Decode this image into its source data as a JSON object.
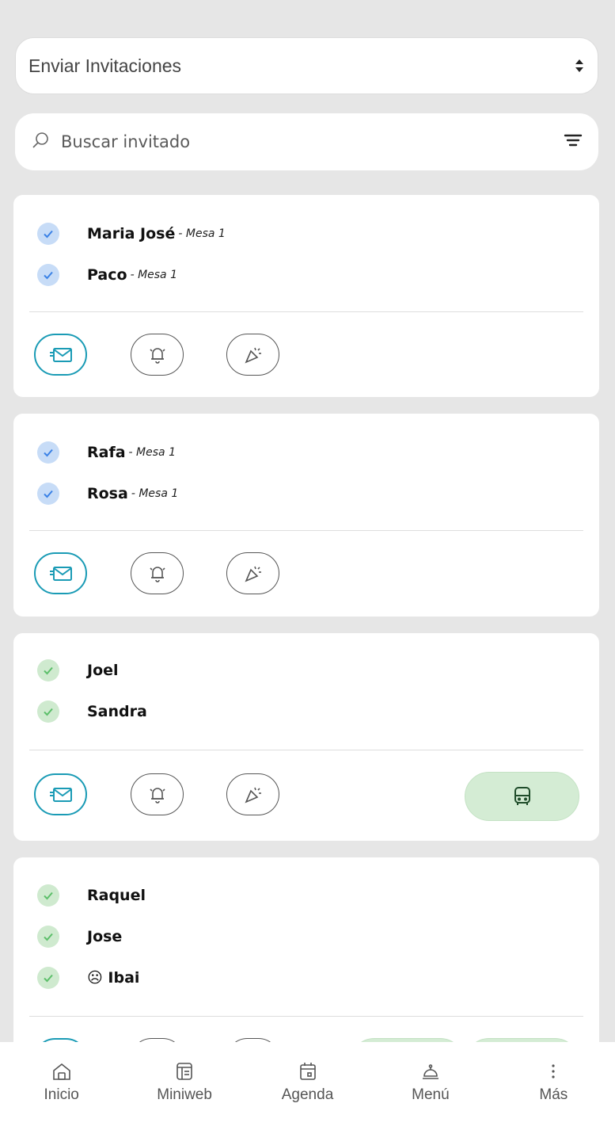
{
  "header": {
    "select_value": "Enviar Invitaciones",
    "search_placeholder": "Buscar invitado"
  },
  "groups": [
    {
      "guests": [
        {
          "name": "Maria José",
          "mesa": "- Mesa 1",
          "status": "blue"
        },
        {
          "name": "Paco",
          "mesa": "- Mesa 1",
          "status": "blue"
        }
      ],
      "actions": [
        "mail-icon",
        "bell-icon",
        "party-icon"
      ]
    },
    {
      "guests": [
        {
          "name": "Rafa",
          "mesa": "- Mesa 1",
          "status": "blue"
        },
        {
          "name": "Rosa",
          "mesa": "- Mesa 1",
          "status": "blue"
        }
      ],
      "actions": [
        "mail-icon",
        "bell-icon",
        "party-icon"
      ]
    },
    {
      "guests": [
        {
          "name": "Joel",
          "mesa": "",
          "status": "green"
        },
        {
          "name": "Sandra",
          "mesa": "",
          "status": "green"
        }
      ],
      "actions": [
        "mail-icon",
        "bell-icon",
        "party-icon",
        "bus-icon"
      ]
    },
    {
      "guests": [
        {
          "name": "Raquel",
          "mesa": "",
          "status": "green"
        },
        {
          "name": "Jose",
          "mesa": "",
          "status": "green"
        },
        {
          "name": "☹ Ibai",
          "mesa": "",
          "status": "green"
        }
      ],
      "actions": [
        "mail-icon",
        "bell-icon",
        "party-icon",
        "bus-icon",
        "bus-icon"
      ]
    }
  ],
  "nav": {
    "items": [
      {
        "label": "Inicio",
        "icon": "home-icon"
      },
      {
        "label": "Miniweb",
        "icon": "miniweb-icon"
      },
      {
        "label": "Agenda",
        "icon": "calendar-icon"
      },
      {
        "label": "Menú",
        "icon": "cloche-icon"
      },
      {
        "label": "Más",
        "icon": "more-icon"
      }
    ]
  },
  "colors": {
    "accent": "#1a9bb5",
    "check_blue": "#c7dcf7",
    "check_green": "#cfeacf",
    "pill_green": "#d4ecd4"
  }
}
